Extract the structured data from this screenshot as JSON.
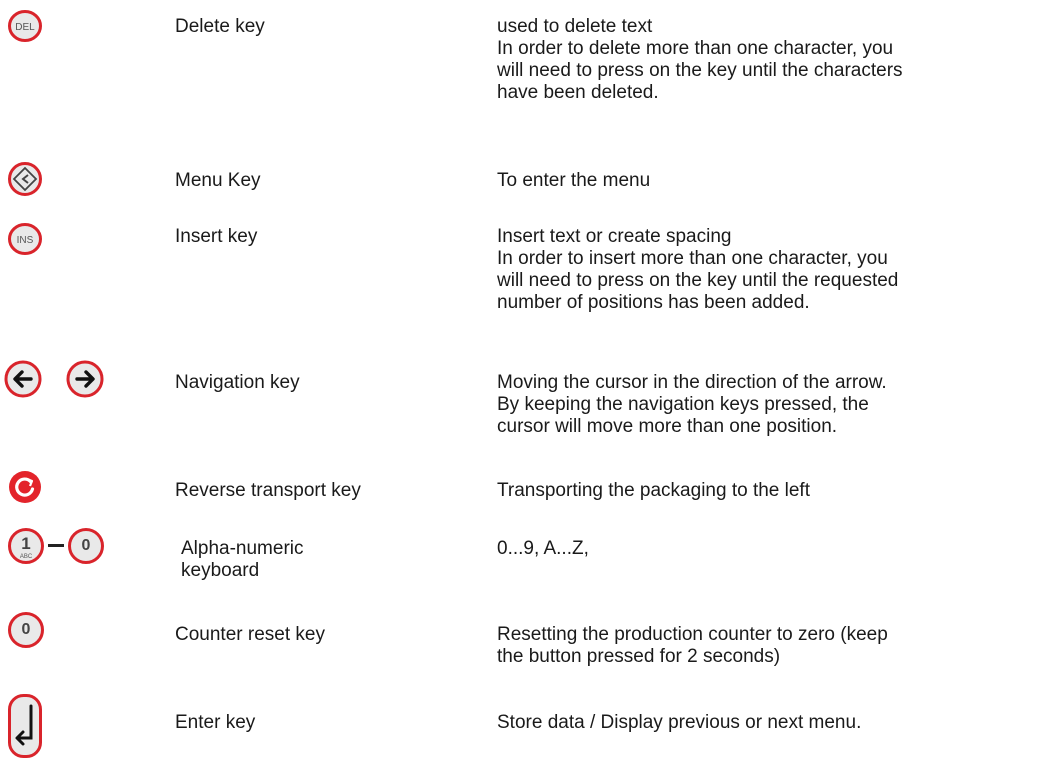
{
  "rows": [
    {
      "name": "Delete key",
      "desc": [
        "used to delete text",
        "In order to delete more than one character, you",
        "will need to press on the key until the characters",
        "have been deleted."
      ],
      "icon": "del-key-icon",
      "icon_text": "DEL"
    },
    {
      "name": "Menu Key",
      "desc": [
        "To enter the menu"
      ],
      "icon": "menu-key-icon"
    },
    {
      "name": "Insert key",
      "desc": [
        "Insert text or create spacing",
        "In order to insert more than one character, you",
        "will need to press on the key until the requested",
        "number of positions has been added."
      ],
      "icon": "ins-key-icon",
      "icon_text": "INS"
    },
    {
      "name": "Navigation key",
      "desc": [
        "Moving the cursor in the direction of the arrow.",
        "By keeping the navigation keys pressed, the",
        "cursor will move more than one position."
      ],
      "icon": "arrow-left-right-icons"
    },
    {
      "name": "Reverse transport key",
      "desc": [
        "Transporting the packaging to the left"
      ],
      "icon": "reverse-transport-icon"
    },
    {
      "name_lines": [
        "Alpha-numeric",
        "keyboard"
      ],
      "desc": [
        "0...9,  A...Z,"
      ],
      "icon": "alphanumeric-keys-icon",
      "icon_text_1": "1",
      "icon_sub_1": "ABC",
      "icon_text_0": "0"
    },
    {
      "name": "Counter reset key",
      "desc": [
        "Resetting the production counter to zero (keep",
        "the button pressed for 2 seconds)"
      ],
      "icon": "counter-reset-icon",
      "icon_text": "0"
    },
    {
      "name": "Enter key",
      "desc": [
        "Store data / Display previous or next menu."
      ],
      "icon": "enter-key-icon"
    }
  ],
  "colors": {
    "key_ring": "#d9242b",
    "key_fill": "#e9e9e9",
    "reverse_fill": "#e3242b"
  }
}
